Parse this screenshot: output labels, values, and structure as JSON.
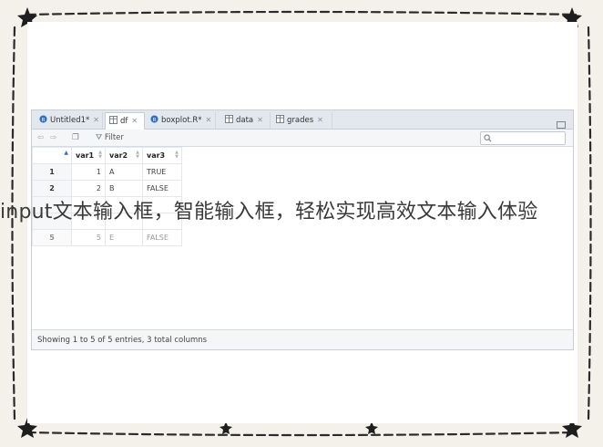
{
  "tabs": [
    {
      "label": "Untitled1*",
      "icon": "r-script-icon",
      "active": false
    },
    {
      "label": "df",
      "icon": "table-icon",
      "active": true
    },
    {
      "label": "boxplot.R*",
      "icon": "r-script-icon",
      "active": false
    },
    {
      "label": "data",
      "icon": "table-icon",
      "active": false
    },
    {
      "label": "grades",
      "icon": "table-icon",
      "active": false
    }
  ],
  "toolbar": {
    "filter_label": "Filter"
  },
  "table": {
    "columns": [
      "var1",
      "var2",
      "var3"
    ],
    "rows": [
      {
        "rn": "1",
        "var1": "1",
        "var2": "A",
        "var3": "TRUE"
      },
      {
        "rn": "2",
        "var1": "2",
        "var2": "B",
        "var3": "FALSE"
      },
      {
        "rn": "",
        "var1": "",
        "var2": "",
        "var3": ""
      },
      {
        "rn": "",
        "var1": "",
        "var2": "",
        "var3": ""
      },
      {
        "rn": "5",
        "var1": "5",
        "var2": "E",
        "var3": "FALSE"
      }
    ]
  },
  "status": "Showing 1 to 5 of 5 entries, 3 total columns",
  "overlay": "input文本输入框，智能输入框，轻松实现高效文本输入体验"
}
